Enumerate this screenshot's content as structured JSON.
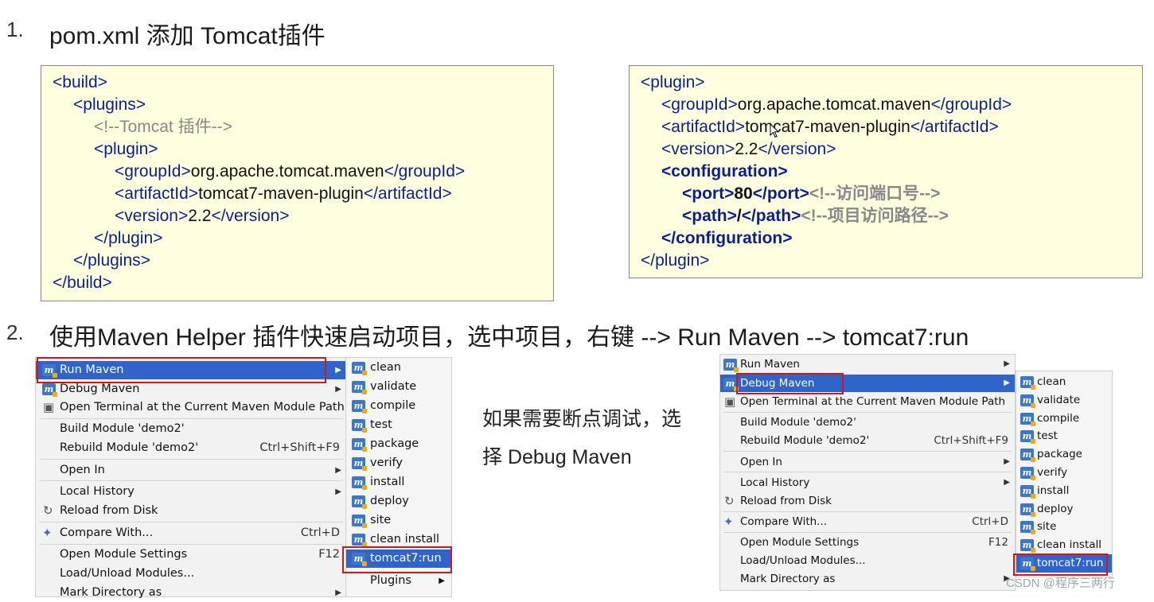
{
  "step1": {
    "number": "1.",
    "title": "pom.xml 添加 Tomcat插件"
  },
  "code_left": {
    "build_open": "<build>",
    "plugins_open": "<plugins>",
    "comment": "<!--Tomcat 插件-->",
    "plugin_open": "<plugin>",
    "groupId_open": "<groupId>",
    "groupId_val": "org.apache.tomcat.maven",
    "groupId_close": "</groupId>",
    "artifactId_open": "<artifactId>",
    "artifactId_val": "tomcat7-maven-plugin",
    "artifactId_close": "</artifactId>",
    "version_open": "<version>",
    "version_val": "2.2",
    "version_close": "</version>",
    "plugin_close": "</plugin>",
    "plugins_close": "</plugins>",
    "build_close": "</build>"
  },
  "code_right": {
    "plugin_open": "<plugin>",
    "groupId_open": "<groupId>",
    "groupId_val": "org.apache.tomcat.maven",
    "groupId_close": "</groupId>",
    "artifactId_open": "<artifactId>",
    "artifactId_val": "tomcat7-maven-plugin",
    "artifactId_close": "</artifactId>",
    "version_open": "<version>",
    "version_val": "2.2",
    "version_close": "</version>",
    "config_open": "<configuration>",
    "port_open": "<port>",
    "port_val": "80",
    "port_close": "</port>",
    "port_comment": "<!--访问端口号-->",
    "path_open": "<path>",
    "path_val": "/",
    "path_close": "</path>",
    "path_comment": "<!--项目访问路径-->",
    "config_close": "</configuration>",
    "plugin_close": "</plugin>"
  },
  "step2": {
    "number": "2.",
    "title": "使用Maven Helper 插件快速启动项目，选中项目，右键 --> Run Maven --> tomcat7:run"
  },
  "note": {
    "line1": "如果需要断点调试，选",
    "line2": "择 Debug Maven"
  },
  "menu_left": {
    "run_maven": "Run Maven",
    "debug_maven": "Debug Maven",
    "open_terminal": "Open Terminal at the Current Maven Module Path",
    "build_module": "Build Module 'demo2'",
    "rebuild_module": "Rebuild Module 'demo2'",
    "rebuild_shortcut": "Ctrl+Shift+F9",
    "open_in": "Open In",
    "local_history": "Local History",
    "reload": "Reload from Disk",
    "compare": "Compare With...",
    "compare_shortcut": "Ctrl+D",
    "module_settings": "Open Module Settings",
    "module_settings_shortcut": "F12",
    "load_unload": "Load/Unload Modules...",
    "mark_directory": "Mark Directory as"
  },
  "submenu_left": {
    "items": [
      "clean",
      "validate",
      "compile",
      "test",
      "package",
      "verify",
      "install",
      "deploy",
      "site",
      "clean install",
      "tomcat7:run"
    ],
    "plugins": "Plugins",
    "icon_letter": "m"
  },
  "menu_right": {
    "run_maven": "Run Maven",
    "debug_maven": "Debug Maven",
    "open_terminal": "Open Terminal at the Current Maven Module Path",
    "build_module": "Build Module 'demo2'",
    "rebuild_module": "Rebuild Module 'demo2'",
    "rebuild_shortcut": "Ctrl+Shift+F9",
    "open_in": "Open In",
    "local_history": "Local History",
    "reload": "Reload from Disk",
    "compare": "Compare With...",
    "compare_shortcut": "Ctrl+D",
    "module_settings": "Open Module Settings",
    "module_settings_shortcut": "F12",
    "load_unload": "Load/Unload Modules...",
    "mark_directory": "Mark Directory as"
  },
  "submenu_right": {
    "items": [
      "clean",
      "validate",
      "compile",
      "test",
      "package",
      "verify",
      "install",
      "deploy",
      "site",
      "clean install",
      "tomcat7:run"
    ],
    "icon_letter": "m"
  },
  "watermark": "CSDN @程序三两行",
  "colors": {
    "code_bg": "#ffffe0",
    "tag": "#0a1f8f",
    "selection": "#2f65ca",
    "highlight_box": "#d01818"
  }
}
